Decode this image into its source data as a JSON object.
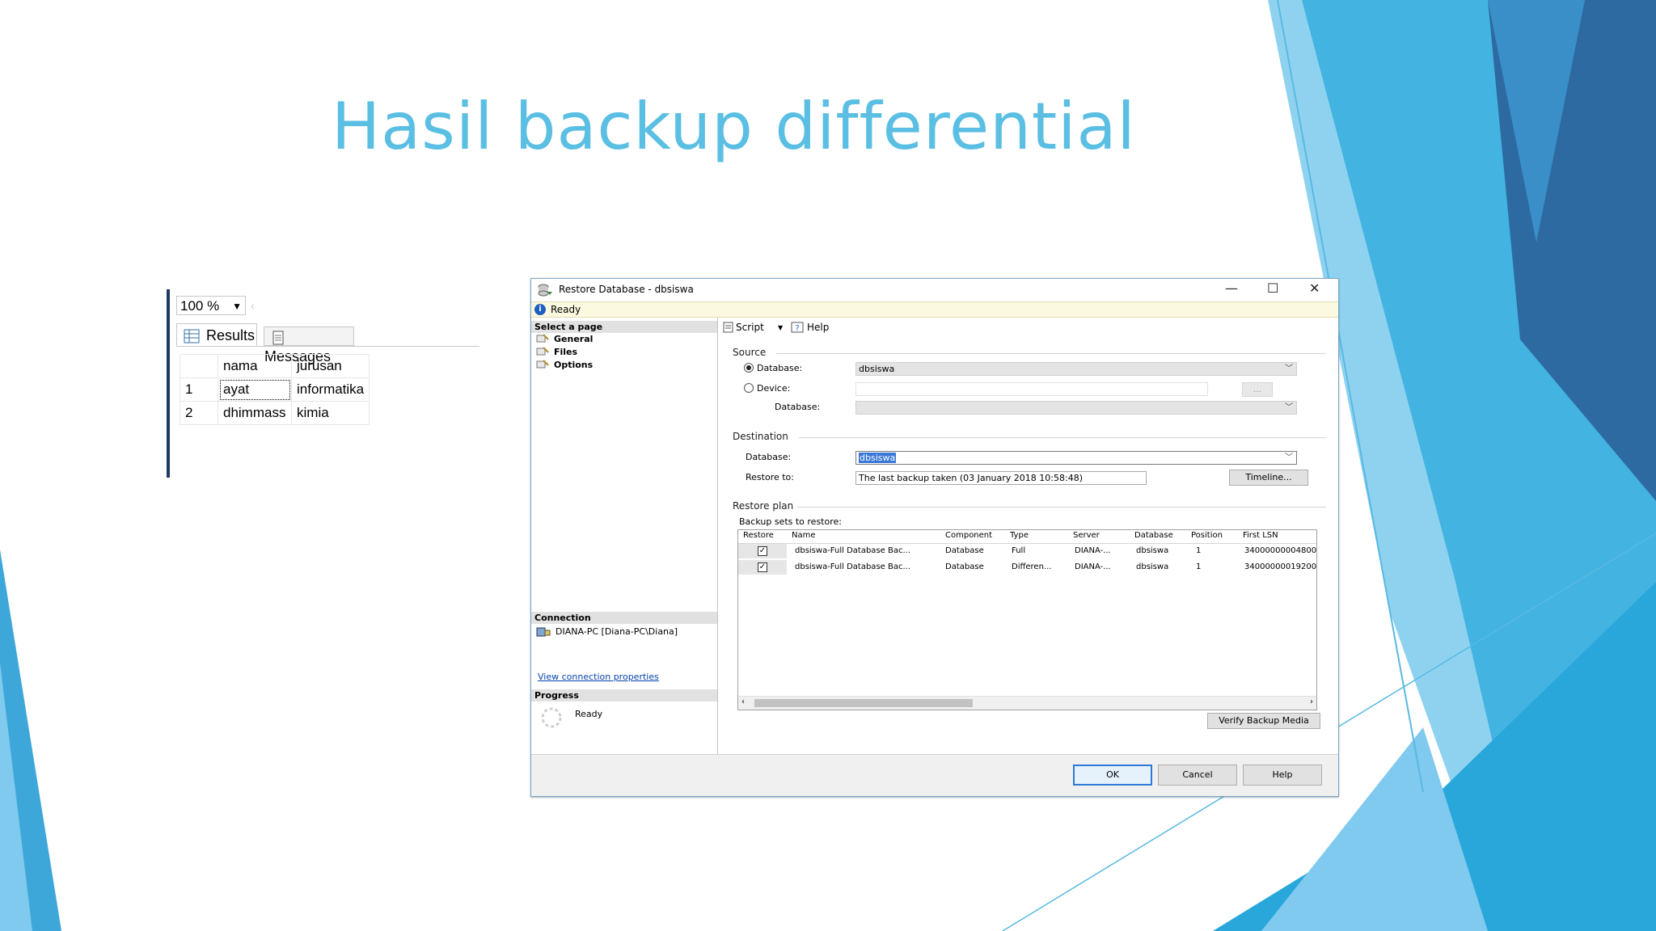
{
  "slide": {
    "title": "Hasil backup differential",
    "accent": "#5bbfe3"
  },
  "results": {
    "zoom": "100 %",
    "tabs": [
      "Results",
      "Messages"
    ],
    "columns": [
      "nama",
      "jurusan"
    ],
    "rows": [
      {
        "n": "1",
        "nama": "ayat",
        "jurusan": "informatika"
      },
      {
        "n": "2",
        "nama": "dhimmass",
        "jurusan": "kimia"
      }
    ]
  },
  "dialog": {
    "title": "Restore Database - dbsiswa",
    "status": "Ready",
    "left": {
      "select_page": "Select a page",
      "pages": [
        "General",
        "Files",
        "Options"
      ],
      "connection_head": "Connection",
      "connection": "DIANA-PC [Diana-PC\\Diana]",
      "view_conn": "View connection properties",
      "progress_head": "Progress",
      "progress": "Ready"
    },
    "toolbar": {
      "script": "Script",
      "help": "Help"
    },
    "source": {
      "head": "Source",
      "database_label": "Database:",
      "database_value": "dbsiswa",
      "device_label": "Device:",
      "device_db_label": "Database:",
      "browse": "..."
    },
    "destination": {
      "head": "Destination",
      "database_label": "Database:",
      "database_value": "dbsiswa",
      "restore_to_label": "Restore to:",
      "restore_to_value": "The last backup taken (03 January 2018 10:58:48)",
      "timeline": "Timeline..."
    },
    "plan": {
      "head": "Restore plan",
      "sets_label": "Backup sets to restore:",
      "columns": [
        "Restore",
        "Name",
        "Component",
        "Type",
        "Server",
        "Database",
        "Position",
        "First LSN"
      ],
      "rows": [
        {
          "name": "dbsiswa-Full Database Bac...",
          "component": "Database",
          "type": "Full",
          "server": "DIANA-...",
          "database": "dbsiswa",
          "position": "1",
          "lsn": "34000000004800"
        },
        {
          "name": "dbsiswa-Full Database Bac...",
          "component": "Database",
          "type": "Differen...",
          "server": "DIANA-...",
          "database": "dbsiswa",
          "position": "1",
          "lsn": "34000000019200"
        }
      ],
      "verify": "Verify Backup Media"
    },
    "buttons": {
      "ok": "OK",
      "cancel": "Cancel",
      "help": "Help"
    }
  }
}
